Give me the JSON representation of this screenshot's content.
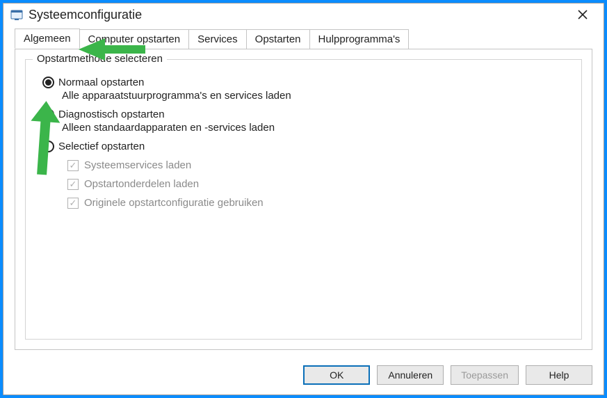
{
  "window": {
    "title": "Systeemconfiguratie"
  },
  "tabs": [
    {
      "label": "Algemeen",
      "active": true
    },
    {
      "label": "Computer opstarten",
      "active": false
    },
    {
      "label": "Services",
      "active": false
    },
    {
      "label": "Opstarten",
      "active": false
    },
    {
      "label": "Hulpprogramma's",
      "active": false
    }
  ],
  "group": {
    "title": "Opstartmethode selecteren",
    "options": [
      {
        "label": "Normaal opstarten",
        "description": "Alle apparaatstuurprogramma's en services laden",
        "selected": true
      },
      {
        "label": "Diagnostisch opstarten",
        "description": "Alleen standaardapparaten en -services laden",
        "selected": false
      },
      {
        "label": "Selectief opstarten",
        "description": "",
        "selected": false,
        "children": [
          {
            "label": "Systeemservices laden",
            "checked": true,
            "disabled": true
          },
          {
            "label": "Opstartonderdelen laden",
            "checked": true,
            "disabled": true
          },
          {
            "label": "Originele opstartconfiguratie gebruiken",
            "checked": true,
            "disabled": true
          }
        ]
      }
    ]
  },
  "buttons": {
    "ok": "OK",
    "cancel": "Annuleren",
    "apply": "Toepassen",
    "help": "Help"
  },
  "annotations": {
    "arrow_color": "#3bb54a"
  }
}
